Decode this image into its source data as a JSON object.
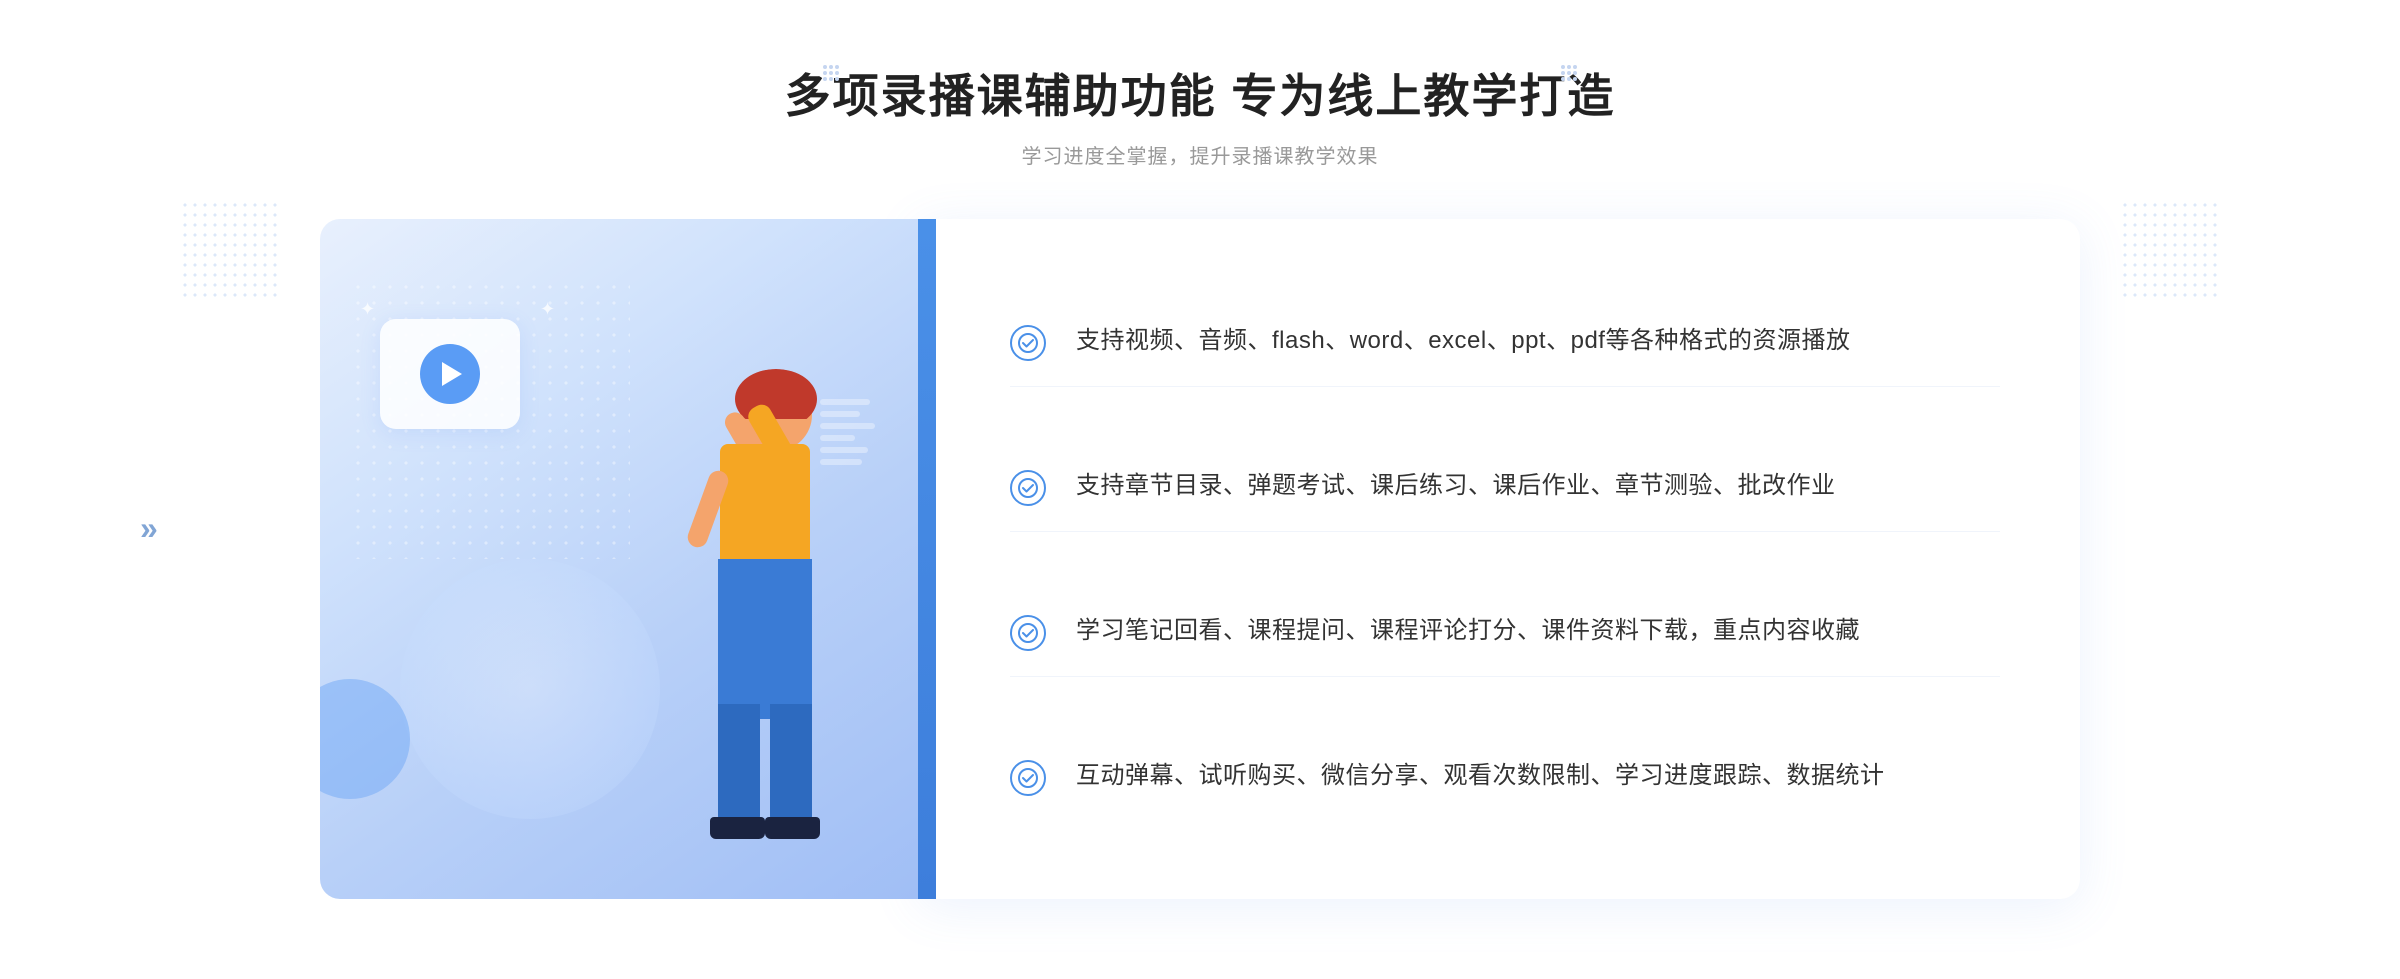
{
  "header": {
    "title": "多项录播课辅助功能 专为线上教学打造",
    "subtitle": "学习进度全掌握，提升录播课教学效果",
    "chevron_left": "❋",
    "chevron_right": "❋"
  },
  "features": [
    {
      "id": 1,
      "text": "支持视频、音频、flash、word、excel、ppt、pdf等各种格式的资源播放"
    },
    {
      "id": 2,
      "text": "支持章节目录、弹题考试、课后练习、课后作业、章节测验、批改作业"
    },
    {
      "id": 3,
      "text": "学习笔记回看、课程提问、课程评论打分、课件资料下载，重点内容收藏"
    },
    {
      "id": 4,
      "text": "互动弹幕、试听购买、微信分享、观看次数限制、学习进度跟踪、数据统计"
    }
  ],
  "decorations": {
    "arrow_left": "»",
    "check_symbol": "✓"
  }
}
